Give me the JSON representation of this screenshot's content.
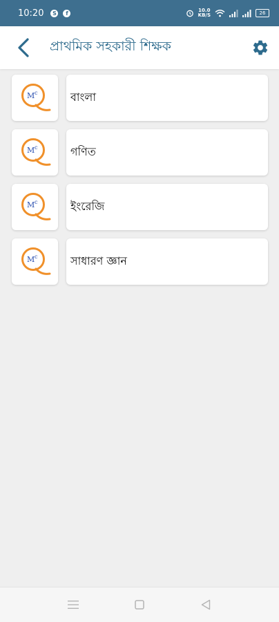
{
  "status_bar": {
    "time": "10:20",
    "notif_icons": [
      "skype-icon",
      "facebook-icon"
    ],
    "net_speed_top": "10.0",
    "net_speed_bottom": "KB/S",
    "battery": "26"
  },
  "app_bar": {
    "title": "প্রাথমিক সহকারী শিক্ষক",
    "back_icon": "chevron-left-icon",
    "settings_icon": "gear-icon"
  },
  "subjects": [
    {
      "label": "বাংলা",
      "logo": "mcq-logo"
    },
    {
      "label": "গণিত",
      "logo": "mcq-logo"
    },
    {
      "label": "ইংরেজি",
      "logo": "mcq-logo"
    },
    {
      "label": "সাধারণ জ্ঞান",
      "logo": "mcq-logo"
    }
  ],
  "colors": {
    "accent": "#2e6b8d",
    "status_bar": "#3e6f8f",
    "logo_orange": "#f0902a",
    "logo_blue": "#2a4fb0"
  }
}
